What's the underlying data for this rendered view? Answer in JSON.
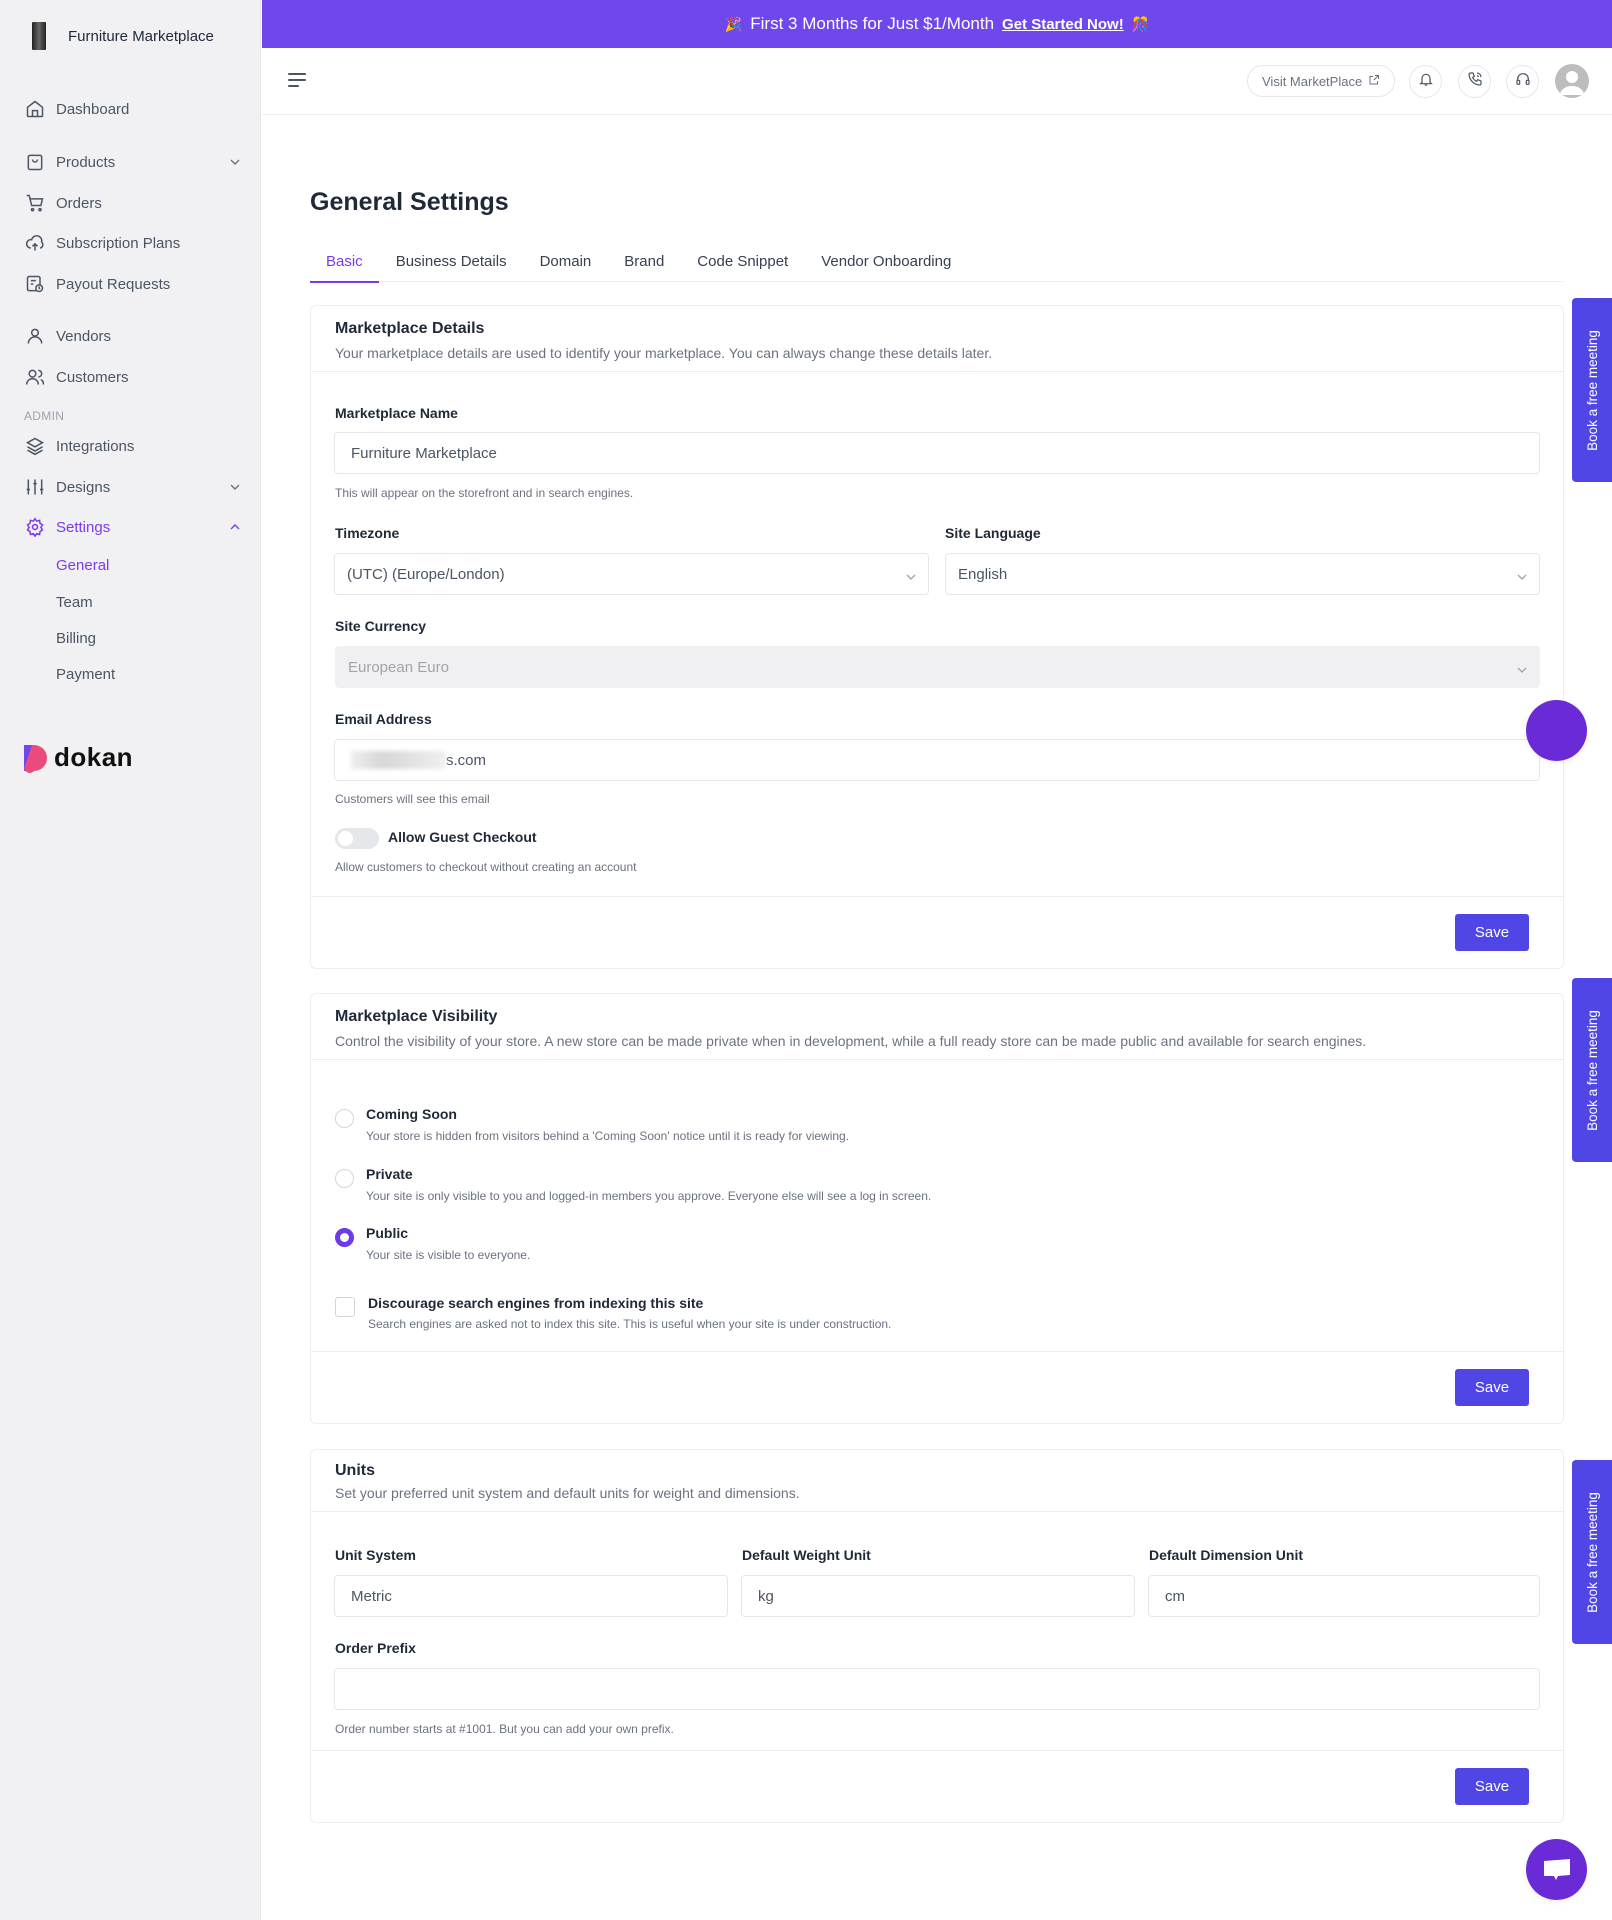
{
  "brand": {
    "store_name": "Furniture Marketplace",
    "platform_logo_text": "dokan"
  },
  "sidebar": {
    "items": [
      {
        "label": "Dashboard",
        "icon": "home-icon"
      },
      {
        "label": "Products",
        "icon": "shopping-bag-icon",
        "expandable": true
      },
      {
        "label": "Orders",
        "icon": "cart-icon"
      },
      {
        "label": "Subscription Plans",
        "icon": "cloud-upload-icon"
      },
      {
        "label": "Payout Requests",
        "icon": "payout-clock-icon"
      },
      {
        "label": "Vendors",
        "icon": "user-icon"
      },
      {
        "label": "Customers",
        "icon": "users-icon"
      }
    ],
    "admin_label": "ADMIN",
    "admin_items": [
      {
        "label": "Integrations",
        "icon": "layers-icon"
      },
      {
        "label": "Designs",
        "icon": "sliders-icon",
        "expandable": true
      },
      {
        "label": "Settings",
        "icon": "gear-icon",
        "expanded": true,
        "active": true
      }
    ],
    "settings_sub": [
      {
        "label": "General",
        "active": true
      },
      {
        "label": "Team"
      },
      {
        "label": "Billing"
      },
      {
        "label": "Payment"
      }
    ]
  },
  "promo": {
    "text": "First 3 Months for Just $1/Month",
    "cta": "Get Started Now!",
    "emoji_left": "🎉",
    "emoji_right": "🎊"
  },
  "topbar": {
    "visit_label": "Visit MarketPlace"
  },
  "page": {
    "title": "General Settings",
    "tabs": [
      {
        "label": "Basic",
        "active": true
      },
      {
        "label": "Business Details"
      },
      {
        "label": "Domain"
      },
      {
        "label": "Brand"
      },
      {
        "label": "Code Snippet"
      },
      {
        "label": "Vendor Onboarding"
      }
    ]
  },
  "details": {
    "title": "Marketplace Details",
    "desc": "Your marketplace details are used to identify your marketplace. You can always change these details later.",
    "name_label": "Marketplace Name",
    "name_value": "Furniture Marketplace",
    "name_help": "This will appear on the storefront and in search engines.",
    "tz_label": "Timezone",
    "tz_value": "(UTC) (Europe/London)",
    "lang_label": "Site Language",
    "lang_value": "English",
    "currency_label": "Site Currency",
    "currency_value": "European Euro",
    "email_label": "Email Address",
    "email_visible_suffix": "s.com",
    "email_help": "Customers will see this email",
    "guest_label": "Allow Guest Checkout",
    "guest_enabled": false,
    "guest_help": "Allow customers to checkout without creating an account",
    "save": "Save"
  },
  "visibility": {
    "title": "Marketplace Visibility",
    "desc": "Control the visibility of your store. A new store can be made private when in development, while a full ready store can be made public and available for search engines.",
    "options": [
      {
        "label": "Coming Soon",
        "desc": "Your store is hidden from visitors behind a 'Coming Soon' notice until it is ready for viewing.",
        "selected": false
      },
      {
        "label": "Private",
        "desc": "Your site is only visible to you and logged-in members you approve. Everyone else will see a log in screen.",
        "selected": false
      },
      {
        "label": "Public",
        "desc": "Your site is visible to everyone.",
        "selected": true
      }
    ],
    "discourage_label": "Discourage search engines from indexing this site",
    "discourage_desc": "Search engines are asked not to index this site. This is useful when your site is under construction.",
    "discourage_checked": false,
    "save": "Save"
  },
  "units": {
    "title": "Units",
    "desc": "Set your preferred unit system and default units for weight and dimensions.",
    "system_label": "Unit System",
    "system_value": "Metric",
    "weight_label": "Default Weight Unit",
    "weight_value": "kg",
    "dim_label": "Default Dimension Unit",
    "dim_value": "cm",
    "prefix_label": "Order Prefix",
    "prefix_value": "",
    "prefix_help": "Order number starts at #1001. But you can add your own prefix.",
    "save": "Save"
  },
  "book_meeting": "Book a free meeting",
  "colors": {
    "accent": "#7c3aed",
    "button": "#4f46e5",
    "promo": "#7047eb",
    "fab": "#6a2bd6"
  }
}
